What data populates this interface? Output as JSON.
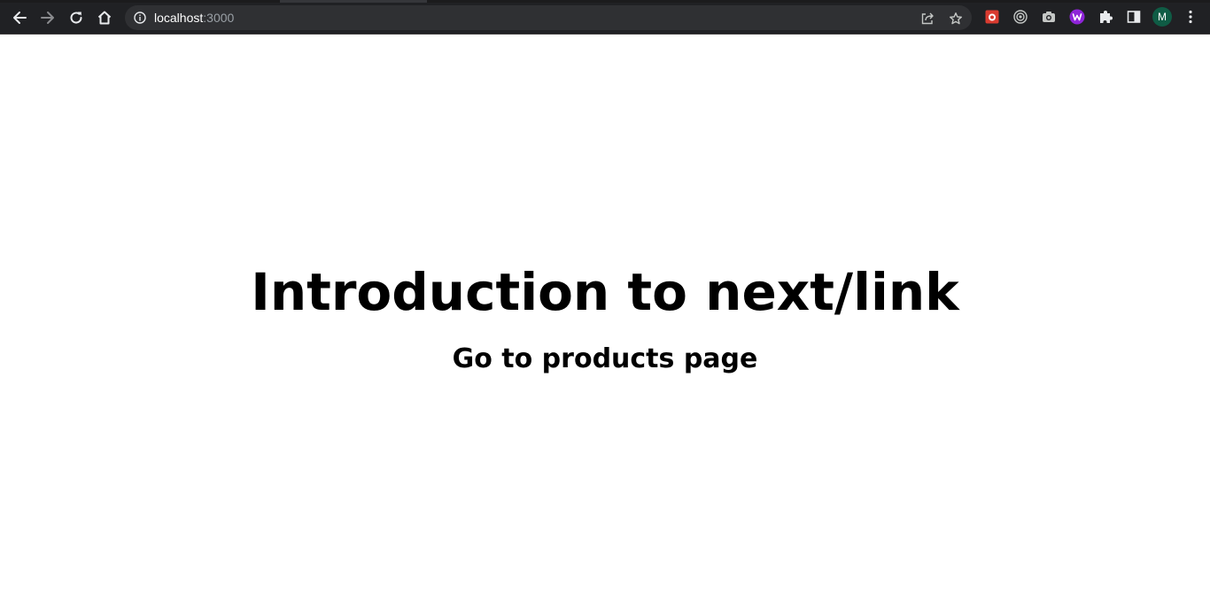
{
  "browser": {
    "url_host": "localhost",
    "url_port": ":3000",
    "profile_initial": "M",
    "icons": {
      "back": "arrow-left-icon",
      "forward": "arrow-right-icon",
      "reload": "reload-icon",
      "home": "home-icon",
      "site_info": "info-icon",
      "share": "share-icon",
      "bookmark": "star-icon",
      "extension_1": "red-extension-icon",
      "extension_2": "target-icon",
      "extension_3": "camera-icon",
      "extension_4": "purple-w-icon",
      "extensions_menu": "puzzle-icon",
      "side_panel": "side-panel-icon",
      "menu": "kebab-menu-icon"
    }
  },
  "page": {
    "title": "Introduction to next/link",
    "link_label": "Go to products page"
  },
  "colors": {
    "chrome_bg": "#202124",
    "omnibox_bg": "#2f3033",
    "avatar_bg": "#0f5c45",
    "page_bg": "#ffffff",
    "text": "#000000"
  }
}
